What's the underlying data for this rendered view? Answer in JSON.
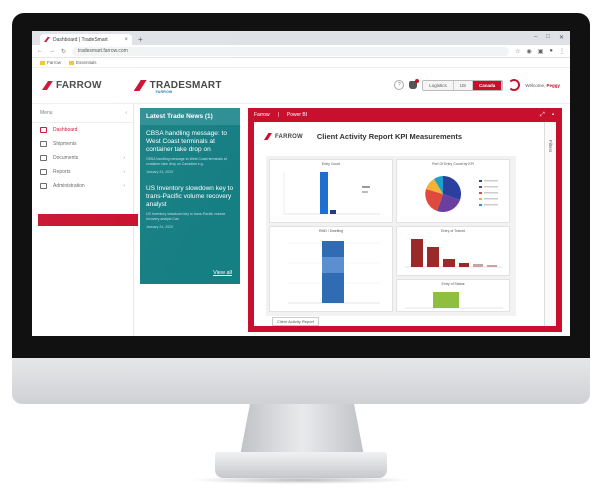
{
  "browser": {
    "tab_title": "Dashboard | TradeSmart",
    "new_tab": "+",
    "url": "tradesmart.farrow.com",
    "bookmarks": [
      "Farrow",
      "Essentials"
    ],
    "window_controls": [
      "–",
      "□",
      "✕"
    ]
  },
  "header": {
    "brand": "FARROW",
    "product": "TRADESMART",
    "product_sub": "FARROW",
    "segments": [
      "Logistics",
      "US",
      "Canada"
    ],
    "active_segment": "Canada",
    "welcome_prefix": "Welcome,",
    "welcome_name": "Peggy"
  },
  "sidebar": {
    "title": "Menu",
    "items": [
      {
        "label": "Dashboard",
        "active": true
      },
      {
        "label": "Shipments",
        "active": false
      },
      {
        "label": "Documents",
        "active": false,
        "has_children": true
      },
      {
        "label": "Reports",
        "active": false,
        "has_children": true
      },
      {
        "label": "Administration",
        "active": false,
        "has_children": true
      }
    ]
  },
  "news": {
    "heading": "Latest Trade News (1)",
    "items": [
      {
        "title": "CBSA handling message: to West Coast terminals at container take drop on",
        "body": "CBSA handling message to West Coast terminals at container take drop on Canadian e.g.",
        "date": "January 24, 2020"
      },
      {
        "title": "US Inventory slowdown key to trans-Pacific volume recovery analyst",
        "body": "US Inventory slowdown key to trans-Pacific volume recovery analyst Can",
        "date": "January 24, 2020"
      }
    ],
    "view_all": "View all"
  },
  "report_panel": {
    "tabs": [
      "Farrow",
      "Power BI"
    ],
    "brand": "FARROW",
    "title": "Client Activity Report KPI Measurements",
    "filters_label": "Filters",
    "bottom_tab": "Client Activity Report",
    "panels": {
      "top_left": "Entry Count",
      "top_right": "Port Of Entry Count by KPI",
      "middle_left": "RMD / Dwelling",
      "middle_right": "Entry of Transit",
      "bottom_right": "Entry of Status"
    }
  },
  "colors": {
    "brand_red": "#c8102e",
    "news_teal": "#167f83",
    "chart_blue": "#1f6fd0",
    "chart_darkred": "#9a2a2a",
    "chart_green": "#8fbf3f"
  }
}
